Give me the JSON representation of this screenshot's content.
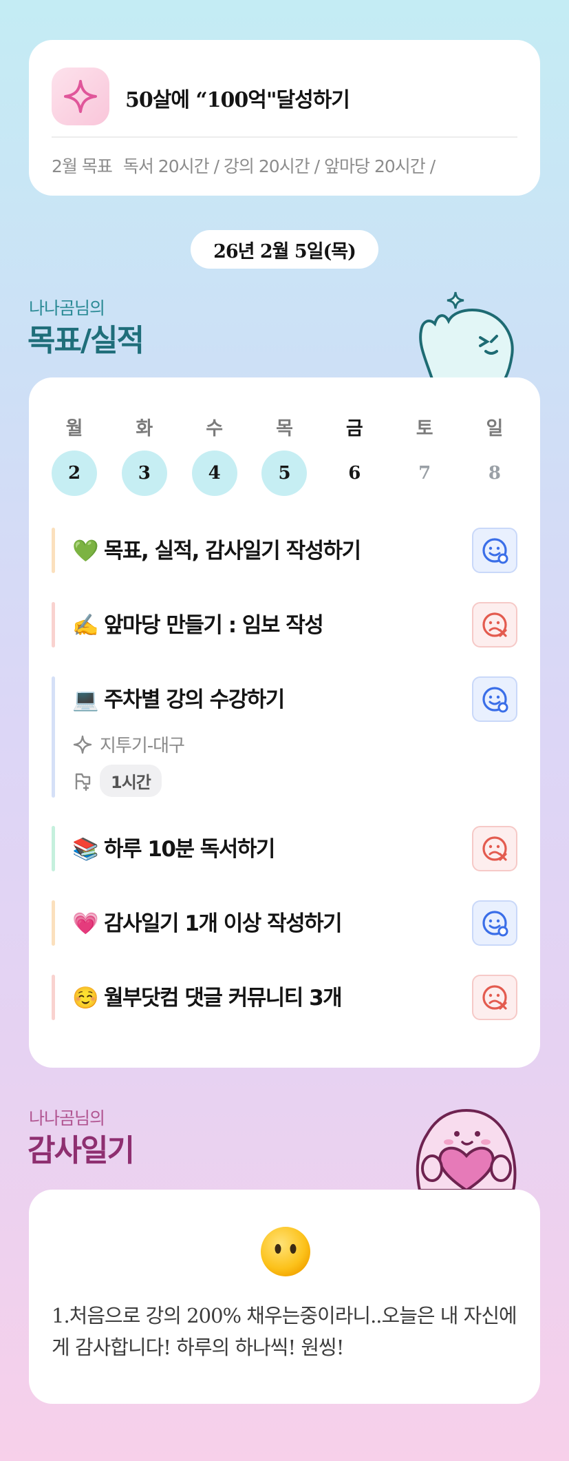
{
  "goal": {
    "title": "50살에 “100억\"달성하기",
    "month_label": "2월 목표",
    "summary": "독서 20시간 / 강의 20시간 / 앞마당 20시간 /"
  },
  "date_label": "26년 2월 5일(목)",
  "goals_section": {
    "owner": "나나곰님의",
    "title": "목표/실적"
  },
  "week": {
    "days": [
      "월",
      "화",
      "수",
      "목",
      "금",
      "토",
      "일"
    ],
    "dates": [
      "2",
      "3",
      "4",
      "5",
      "6",
      "7",
      "8"
    ],
    "done": [
      true,
      true,
      true,
      true,
      false,
      false,
      false
    ],
    "today_index": 4
  },
  "tasks": [
    {
      "emoji": "💚",
      "title": "목표, 실적, 감사일기 작성하기",
      "status": "success",
      "bar_color": "#fbe0bd"
    },
    {
      "emoji": "✍️",
      "title": "앞마당 만들기 : 임보 작성",
      "status": "fail",
      "bar_color": "#f9d2cf"
    },
    {
      "emoji": "💻",
      "title": "주차별 강의 수강하기",
      "status": "success",
      "bar_color": "#d5e0f7",
      "sub_label": "지투기-대구",
      "time": "1시간"
    },
    {
      "emoji": "📚",
      "title": "하루 10분 독서하기",
      "status": "fail",
      "bar_color": "#c5f0dd"
    },
    {
      "emoji": "💗",
      "title": "감사일기 1개 이상 작성하기",
      "status": "success",
      "bar_color": "#fbe0bd"
    },
    {
      "emoji": "☺️",
      "title": "월부닷컴 댓글 커뮤니티 3개",
      "status": "fail",
      "bar_color": "#f9d2cf"
    }
  ],
  "gratitude_section": {
    "owner": "나나곰님의",
    "title": "감사일기"
  },
  "gratitude": {
    "text": "1.처음으로 강의 200% 채우는중이라니..오늘은 내 자신에게 감사합니다! 하루의 하나씩! 원씽!"
  },
  "colors": {
    "accent_teal": "#1f6e7a",
    "accent_plum": "#8e2f70",
    "success": "#3a6ee8",
    "fail": "#e35b4f"
  }
}
